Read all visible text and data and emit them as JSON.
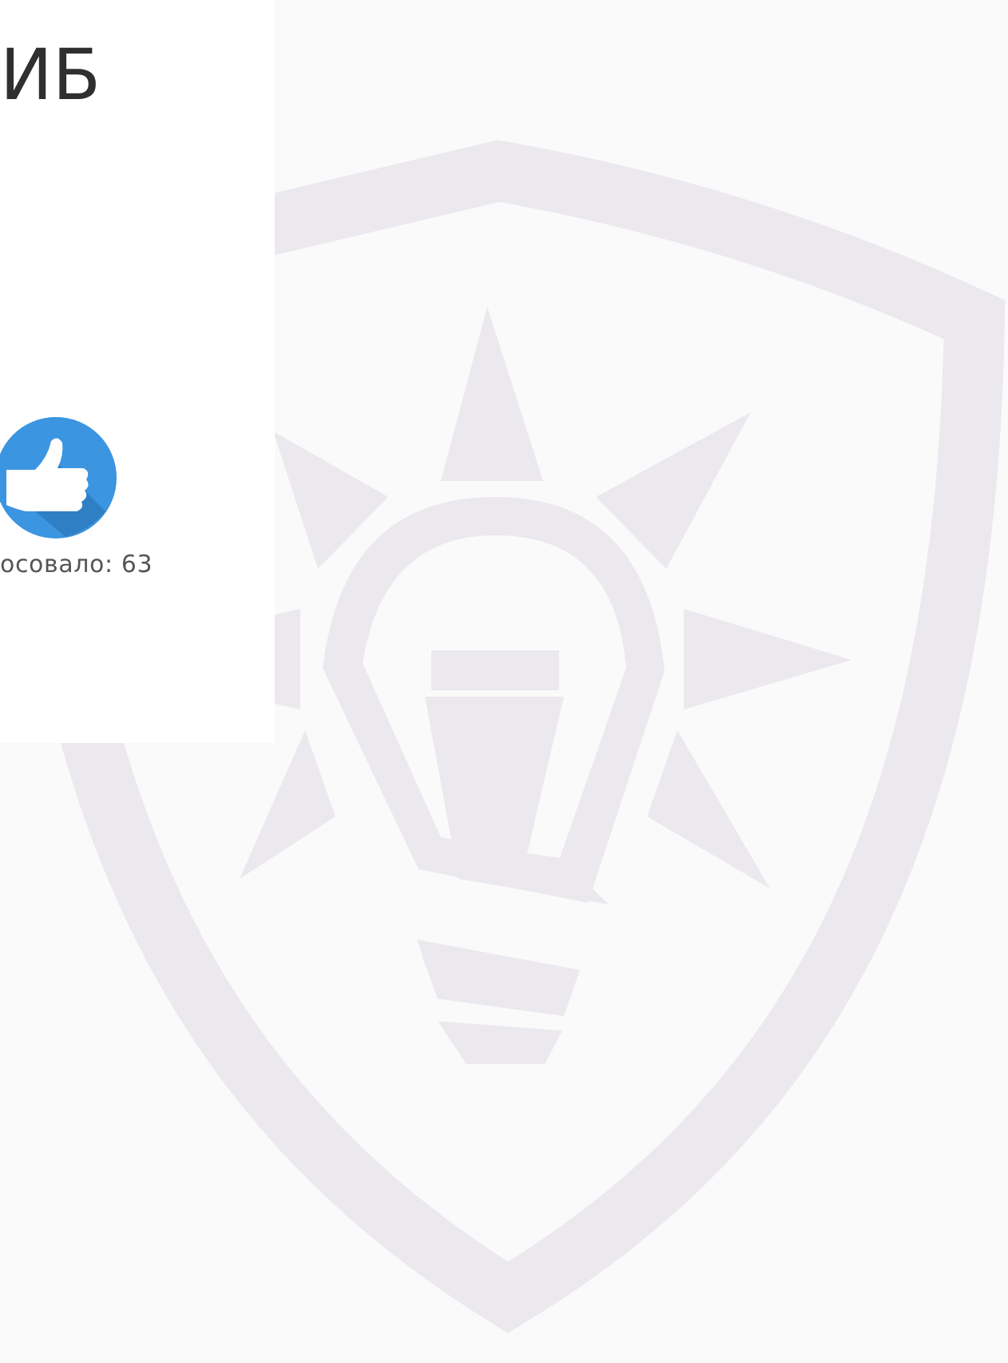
{
  "heading": "ИБ",
  "vote": {
    "count_label": "осовало: 63"
  }
}
